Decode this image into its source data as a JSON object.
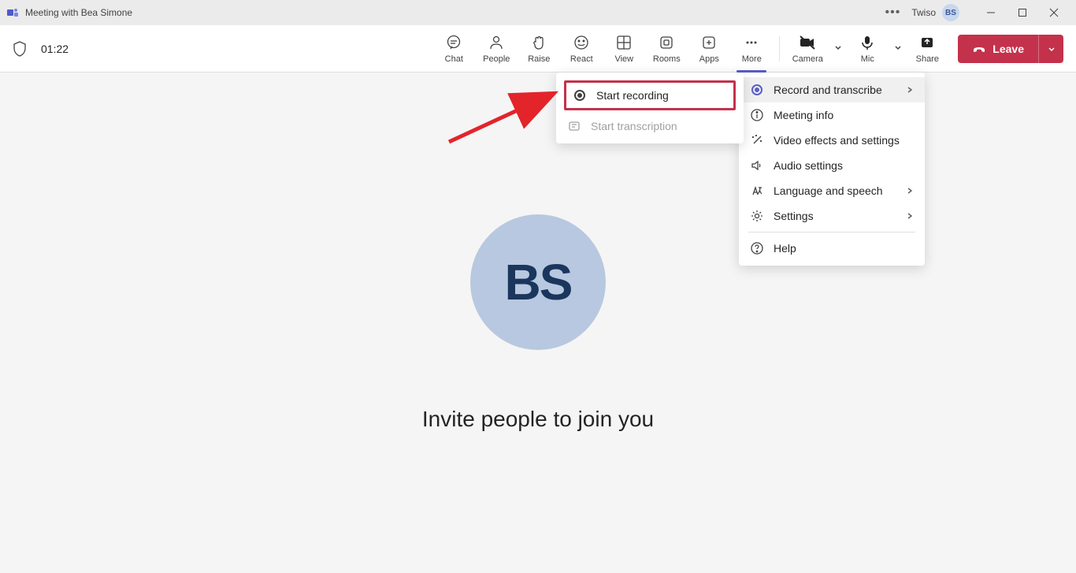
{
  "titleBar": {
    "title": "Meeting with Bea Simone",
    "userLabel": "Twiso",
    "userInitials": "BS"
  },
  "toolbar": {
    "timer": "01:22",
    "buttons": {
      "chat": "Chat",
      "people": "People",
      "raise": "Raise",
      "react": "React",
      "view": "View",
      "rooms": "Rooms",
      "apps": "Apps",
      "more": "More",
      "camera": "Camera",
      "mic": "Mic",
      "share": "Share"
    },
    "leave": "Leave"
  },
  "moreMenu": {
    "items": [
      {
        "label": "Record and transcribe",
        "hasSubmenu": true,
        "highlight": true
      },
      {
        "label": "Meeting info"
      },
      {
        "label": "Video effects and settings"
      },
      {
        "label": "Audio settings"
      },
      {
        "label": "Language and speech",
        "hasSubmenu": true
      },
      {
        "label": "Settings",
        "hasSubmenu": true
      },
      {
        "label": "Help"
      }
    ]
  },
  "submenu": {
    "startRecording": "Start recording",
    "startTranscription": "Start transcription"
  },
  "main": {
    "avatarInitials": "BS",
    "inviteText": "Invite people to join you"
  }
}
